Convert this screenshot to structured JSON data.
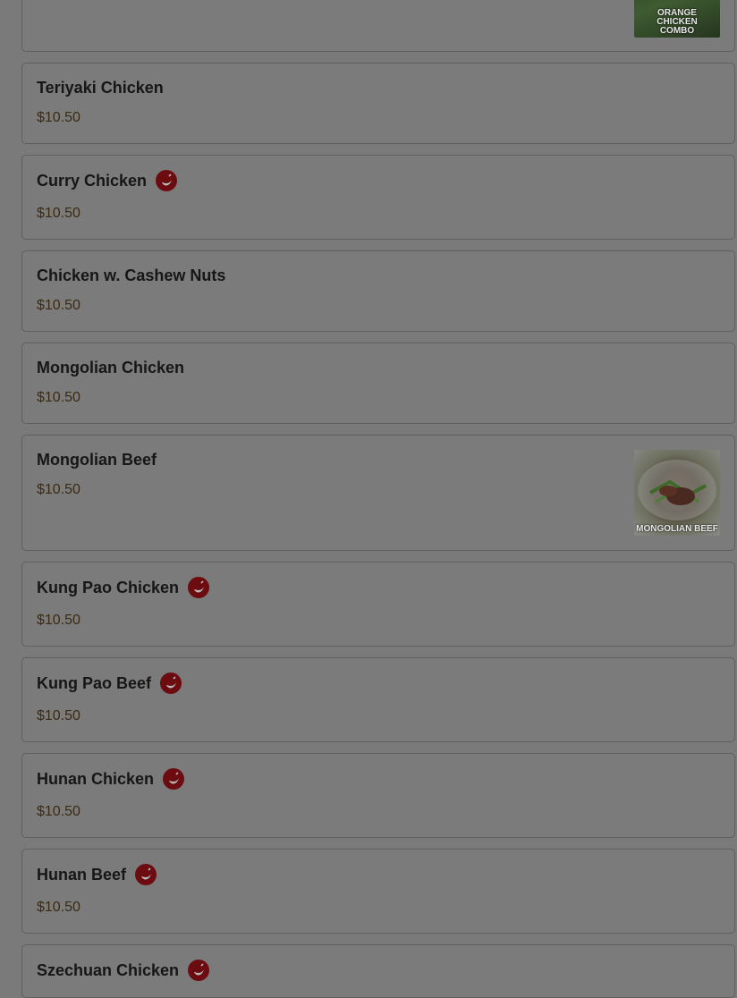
{
  "menu": {
    "items": [
      {
        "name": "",
        "price": "$10.50",
        "image_caption": "ORANGE CHICKEN COMBO",
        "spicy": false
      },
      {
        "name": "Teriyaki Chicken",
        "price": "$10.50",
        "spicy": false
      },
      {
        "name": "Curry Chicken",
        "price": "$10.50",
        "spicy": true
      },
      {
        "name": "Chicken w. Cashew Nuts",
        "price": "$10.50",
        "spicy": false
      },
      {
        "name": "Mongolian Chicken",
        "price": "$10.50",
        "spicy": false
      },
      {
        "name": "Mongolian Beef",
        "price": "$10.50",
        "image_caption": "MONGOLIAN BEEF",
        "spicy": false
      },
      {
        "name": "Kung Pao Chicken",
        "price": "$10.50",
        "spicy": true
      },
      {
        "name": "Kung Pao Beef",
        "price": "$10.50",
        "spicy": true
      },
      {
        "name": "Hunan Chicken",
        "price": "$10.50",
        "spicy": true
      },
      {
        "name": "Hunan Beef",
        "price": "$10.50",
        "spicy": true
      },
      {
        "name": "Szechuan Chicken",
        "price": "",
        "spicy": true
      }
    ]
  },
  "icons": {
    "spicy": "chili-pepper-icon"
  },
  "colors": {
    "overlay": "#7a7a7a",
    "spicy_badge": "#6d0c10"
  }
}
